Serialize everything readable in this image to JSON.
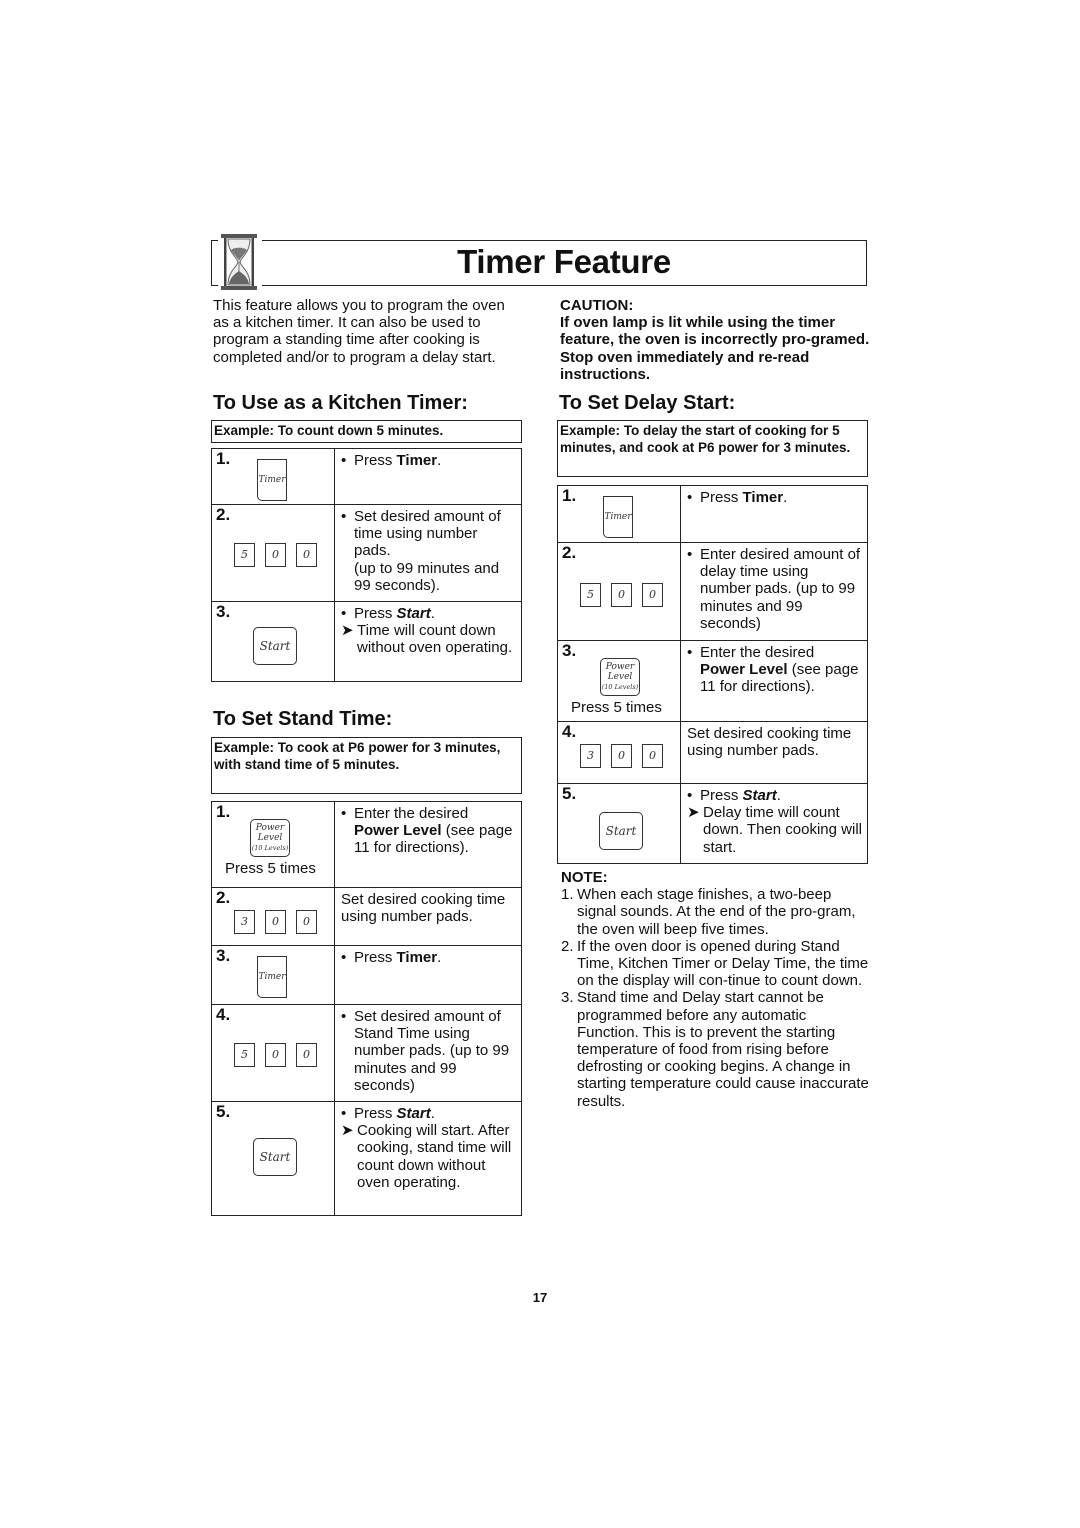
{
  "page": {
    "title": "Timer Feature",
    "title_icon": "hourglass-icon",
    "page_number": "17"
  },
  "intro": "This feature allows you to program the oven as a kitchen timer. It can also be used to program a standing time after cooking is completed and/or to program a delay start.",
  "caution": {
    "heading": "CAUTION:",
    "text": "If oven lamp is lit while using the timer feature, the oven is incorrectly pro-gramed. Stop oven immediately and re-read instructions."
  },
  "kitchen_timer": {
    "heading": "To Use  as a Kitchen Timer:",
    "example_label": "Example:",
    "example_text": "To count down 5 minutes.",
    "steps": [
      {
        "num": "1.",
        "keys": [
          "Timer"
        ],
        "bullet": "•",
        "text_pre": "Press ",
        "text_bold": "Timer",
        "text_post": "."
      },
      {
        "num": "2.",
        "pads": [
          "5",
          "0",
          "0"
        ],
        "bullet": "•",
        "text": "Set desired amount of time using number pads.",
        "text2": "(up to 99 minutes and 99 seconds)."
      },
      {
        "num": "3.",
        "keys": [
          "Start"
        ],
        "bullet": "•",
        "text_pre": "Press ",
        "text_bold": "Start",
        "text_post": ".",
        "arrow": "➤",
        "arrow_text": "Time will count down without oven operating."
      }
    ]
  },
  "stand_time": {
    "heading": "To Set Stand Time:",
    "example_label": "Example:",
    "example_text": "To cook at P6 power for 3 minutes, with stand time of 5 minutes.",
    "steps": [
      {
        "num": "1.",
        "key_power": {
          "line1": "Power",
          "line2": "Level",
          "line3": "(10 Levels)"
        },
        "caption": "Press 5 times",
        "bullet": "•",
        "text_pre": "Enter the desired ",
        "text_bold": "Power Level",
        "text_post": " (see page 11 for directions)."
      },
      {
        "num": "2.",
        "pads": [
          "3",
          "0",
          "0"
        ],
        "text": "Set desired cooking time using number pads."
      },
      {
        "num": "3.",
        "keys": [
          "Timer"
        ],
        "bullet": "•",
        "text_pre": "Press ",
        "text_bold": "Timer",
        "text_post": "."
      },
      {
        "num": "4.",
        "pads": [
          "5",
          "0",
          "0"
        ],
        "bullet": "•",
        "text": "Set desired amount of Stand Time using number pads. (up to 99 minutes and 99 seconds)"
      },
      {
        "num": "5.",
        "keys": [
          "Start"
        ],
        "bullet": "•",
        "text_pre": "Press ",
        "text_bold": "Start",
        "text_post": ".",
        "arrow": "➤",
        "arrow_text": "Cooking will start. After cooking, stand time will count down without oven operating."
      }
    ]
  },
  "delay_start": {
    "heading": "To Set Delay Start:",
    "example_label": "Example:",
    "example_text": "To delay the start of cooking for 5 minutes, and cook at P6 power for 3 minutes.",
    "steps": [
      {
        "num": "1.",
        "keys": [
          "Timer"
        ],
        "bullet": "•",
        "text_pre": "Press ",
        "text_bold": "Timer",
        "text_post": "."
      },
      {
        "num": "2.",
        "pads": [
          "5",
          "0",
          "0"
        ],
        "bullet": "•",
        "text": "Enter desired amount of delay time using number pads. (up to 99 minutes and 99 seconds)"
      },
      {
        "num": "3.",
        "key_power": {
          "line1": "Power",
          "line2": "Level",
          "line3": "(10 Levels)"
        },
        "caption": "Press 5 times",
        "bullet": "•",
        "text_pre": "Enter the desired ",
        "text_bold": "Power Level",
        "text_post": " (see page 11 for directions)."
      },
      {
        "num": "4.",
        "pads": [
          "3",
          "0",
          "0"
        ],
        "text": "Set desired cooking time using number pads."
      },
      {
        "num": "5.",
        "keys": [
          "Start"
        ],
        "bullet": "•",
        "text_pre": "Press ",
        "text_bold": "Start",
        "text_post": ".",
        "arrow": "➤",
        "arrow_text": "Delay time will count down. Then cooking will start."
      }
    ]
  },
  "note": {
    "heading": "NOTE:",
    "items": [
      {
        "n": "1.",
        "text": "When each stage finishes, a two-beep signal sounds. At the end of the pro-gram, the oven will beep five times."
      },
      {
        "n": "2.",
        "text": "If the oven door is opened during Stand Time, Kitchen Timer or Delay Time, the time on the display will con-tinue to count down."
      },
      {
        "n": "3.",
        "text": "Stand time and Delay start cannot be programmed before any automatic Function. This is to prevent the starting temperature of food from rising before defrosting or cooking begins. A change in starting temperature could cause inaccurate results."
      }
    ]
  }
}
